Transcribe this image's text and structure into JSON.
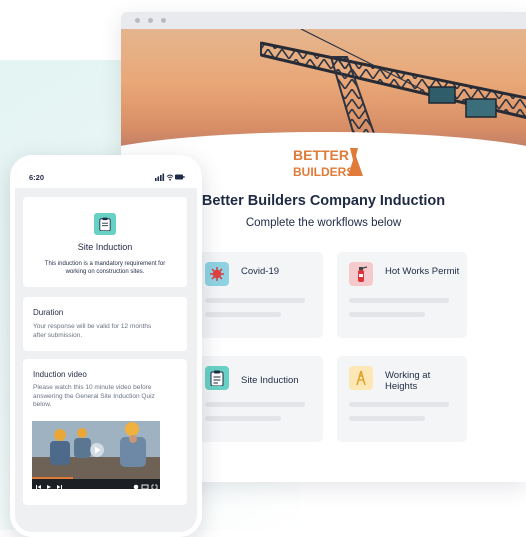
{
  "browser": {
    "logo_text_line1": "BETTER",
    "logo_text_line2": "BUILDERS",
    "title": "Better Builders Company Induction",
    "subtitle": "Complete the workflows below",
    "workflows": [
      {
        "label": "Covid-19",
        "icon": "virus-icon",
        "icon_bg": "#8fd3e3"
      },
      {
        "label": "Hot Works Permit",
        "icon": "fire-extinguisher-icon",
        "icon_bg": "#f6c9cc"
      },
      {
        "label": "Site Induction",
        "icon": "clipboard-icon",
        "icon_bg": "#66d1c4"
      },
      {
        "label": "Working at Heights",
        "icon": "ladder-icon",
        "icon_bg": "#fde7b5"
      }
    ]
  },
  "phone": {
    "time": "6:20",
    "induction": {
      "title": "Site Induction",
      "description": "This induction is a mandatory requirement for working on construction sites."
    },
    "duration": {
      "title": "Duration",
      "text": "Your response will be valid for 12 months after submission."
    },
    "video": {
      "title": "Induction video",
      "text": "Please watch this 10 minute video before answering the General Site Induction Quiz below.",
      "progress": 0.32
    }
  },
  "colors": {
    "brand_orange": "#e07b39",
    "navy": "#1f2a44",
    "teal": "#66d1c4"
  }
}
